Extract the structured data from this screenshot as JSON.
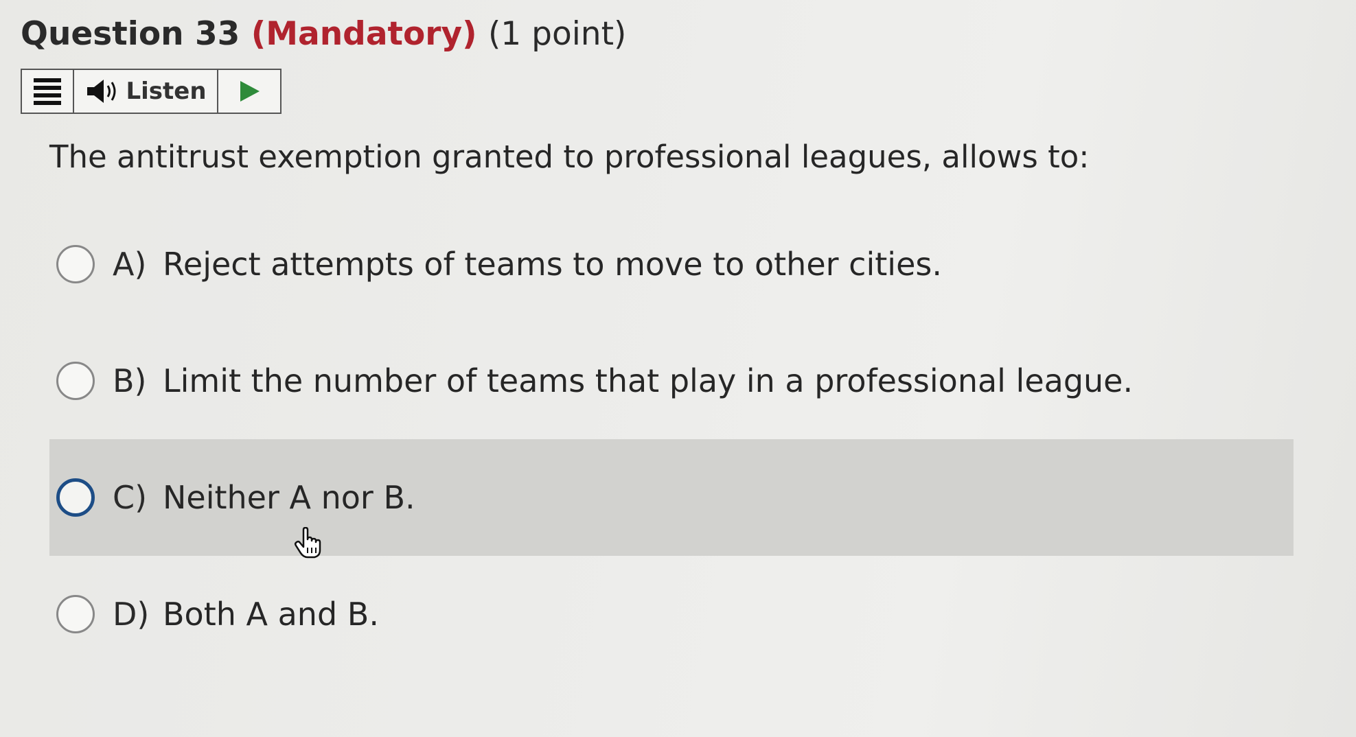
{
  "question": {
    "title": "Question 33",
    "mandatory": "(Mandatory)",
    "points": "(1 point)",
    "prompt": "The antitrust exemption granted to professional leagues, allows to:"
  },
  "toolbar": {
    "menu_icon": "hamburger-menu-icon",
    "listen_icon": "speaker-icon",
    "listen_label": "Listen",
    "play_icon": "play-icon"
  },
  "options": [
    {
      "letter": "A)",
      "text": "Reject attempts of teams to move to other cities.",
      "selected": false,
      "hovered": false
    },
    {
      "letter": "B)",
      "text": "Limit the number of teams that play in a professional league.",
      "selected": false,
      "hovered": false
    },
    {
      "letter": "C)",
      "text": "Neither A nor B.",
      "selected": false,
      "hovered": true
    },
    {
      "letter": "D)",
      "text": "Both A and B.",
      "selected": false,
      "hovered": false
    }
  ],
  "colors": {
    "mandatory": "#b0232e",
    "radio_focus": "#1d4d86",
    "hover_row": "#d2d2cf",
    "play": "#2e8b3a"
  }
}
